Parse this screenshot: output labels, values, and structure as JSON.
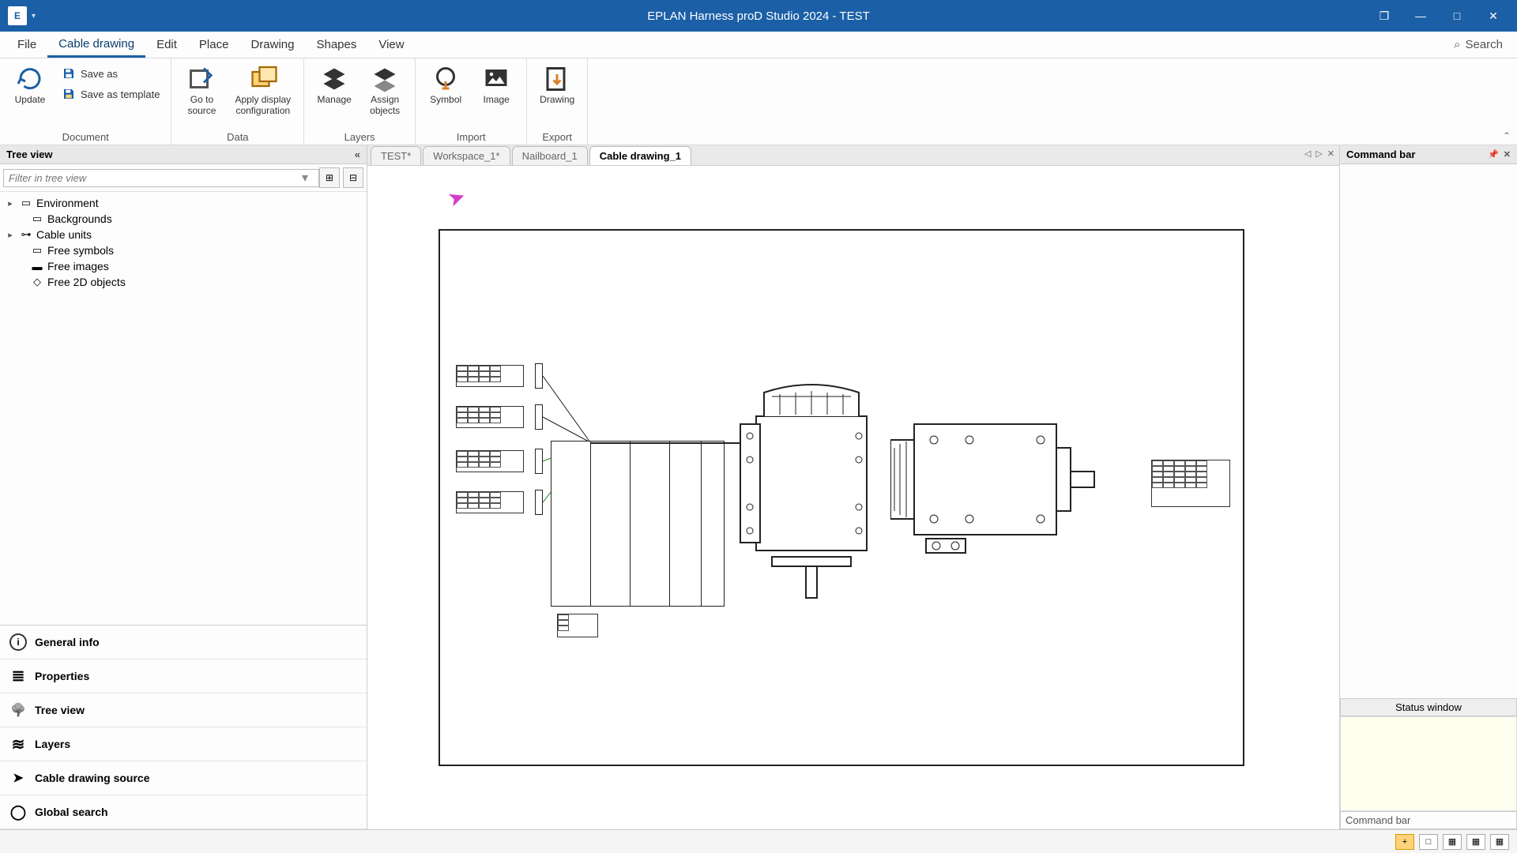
{
  "title": "EPLAN Harness proD Studio 2024 - TEST",
  "menu": {
    "items": [
      "File",
      "Cable drawing",
      "Edit",
      "Place",
      "Drawing",
      "Shapes",
      "View"
    ],
    "active_index": 1,
    "search_label": "Search"
  },
  "ribbon": {
    "groups": [
      {
        "label": "Document",
        "big_buttons": [
          {
            "label": "Update",
            "icon": "refresh-icon"
          }
        ],
        "small_buttons": [
          {
            "label": "Save as",
            "icon": "save-icon"
          },
          {
            "label": "Save as template",
            "icon": "save-template-icon"
          }
        ]
      },
      {
        "label": "Data",
        "big_buttons": [
          {
            "label": "Go to\nsource",
            "icon": "goto-source-icon"
          },
          {
            "label": "Apply display\nconfiguration",
            "icon": "apply-display-icon"
          }
        ]
      },
      {
        "label": "Layers",
        "big_buttons": [
          {
            "label": "Manage",
            "icon": "layers-manage-icon"
          },
          {
            "label": "Assign\nobjects",
            "icon": "layers-assign-icon"
          }
        ]
      },
      {
        "label": "Import",
        "big_buttons": [
          {
            "label": "Symbol",
            "icon": "import-symbol-icon"
          },
          {
            "label": "Image",
            "icon": "import-image-icon"
          }
        ]
      },
      {
        "label": "Export",
        "big_buttons": [
          {
            "label": "Drawing",
            "icon": "export-drawing-icon"
          }
        ]
      }
    ]
  },
  "left_panel": {
    "title": "Tree view",
    "filter_placeholder": "Filter in tree view",
    "tree": [
      {
        "label": "Environment",
        "expandable": true,
        "icon": "env-icon"
      },
      {
        "label": "Backgrounds",
        "expandable": false,
        "icon": "bg-icon"
      },
      {
        "label": "Cable units",
        "expandable": true,
        "icon": "cable-icon"
      },
      {
        "label": "Free symbols",
        "expandable": false,
        "icon": "symbol-icon"
      },
      {
        "label": "Free images",
        "expandable": false,
        "icon": "image-icon"
      },
      {
        "label": "Free 2D objects",
        "expandable": false,
        "icon": "obj2d-icon"
      }
    ],
    "side_tabs": [
      {
        "label": "General info",
        "icon": "info"
      },
      {
        "label": "Properties",
        "icon": "lines"
      },
      {
        "label": "Tree view",
        "icon": "tree",
        "active": true
      },
      {
        "label": "Layers",
        "icon": "layers"
      },
      {
        "label": "Cable drawing source",
        "icon": "arrow"
      },
      {
        "label": "Global search",
        "icon": "search"
      }
    ]
  },
  "doc_tabs": {
    "tabs": [
      "TEST*",
      "Workspace_1*",
      "Nailboard_1",
      "Cable drawing_1"
    ],
    "active_index": 3
  },
  "right_panel": {
    "title": "Command bar",
    "status_title": "Status window",
    "cmd_prompt": "Command bar"
  },
  "statusbar": {
    "buttons": [
      "+",
      "□",
      "▦",
      "▦",
      "▦"
    ]
  }
}
